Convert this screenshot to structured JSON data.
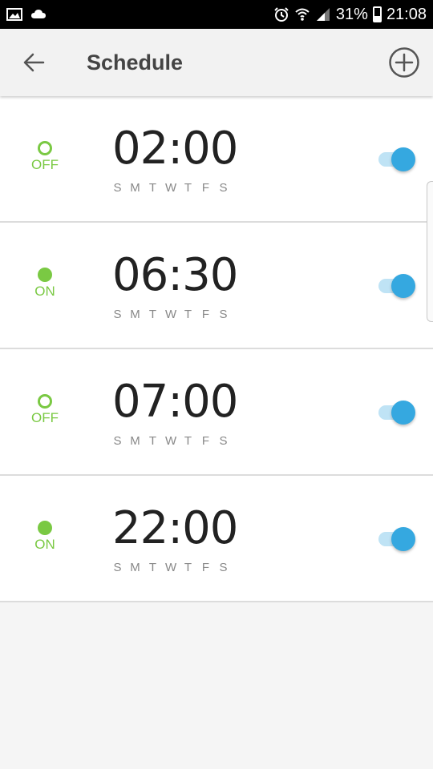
{
  "status_bar": {
    "left_icons": [
      "gallery-icon",
      "cloud-icon"
    ],
    "right_icons": [
      "alarm-icon",
      "wifi-icon",
      "signal-icon"
    ],
    "battery": "31%",
    "time": "21:08"
  },
  "app_bar": {
    "title": "Schedule",
    "back_icon": "arrow-left-icon",
    "add_icon": "plus-circle-icon"
  },
  "schedules": [
    {
      "state": "OFF",
      "time": "02:00",
      "days": [
        "S",
        "M",
        "T",
        "W",
        "T",
        "F",
        "S"
      ],
      "enabled": true
    },
    {
      "state": "ON",
      "time": "06:30",
      "days": [
        "S",
        "M",
        "T",
        "W",
        "T",
        "F",
        "S"
      ],
      "enabled": true
    },
    {
      "state": "OFF",
      "time": "07:00",
      "days": [
        "S",
        "M",
        "T",
        "W",
        "T",
        "F",
        "S"
      ],
      "enabled": true
    },
    {
      "state": "ON",
      "time": "22:00",
      "days": [
        "S",
        "M",
        "T",
        "W",
        "T",
        "F",
        "S"
      ],
      "enabled": true
    }
  ],
  "colors": {
    "state_green": "#7ac943",
    "toggle_blue": "#35a8e0",
    "toggle_track": "#bfe3f5"
  }
}
